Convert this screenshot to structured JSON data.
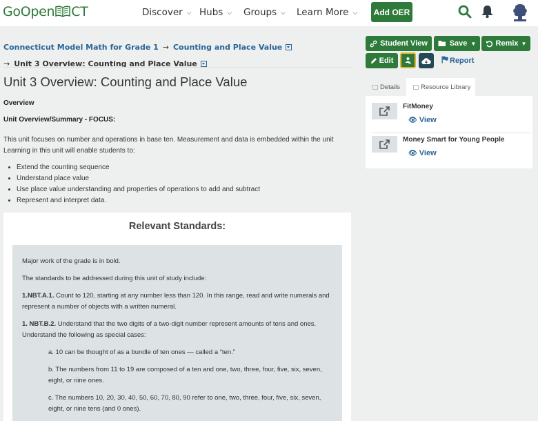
{
  "header": {
    "logo_pre": "GoOpen",
    "logo_post": "CT",
    "nav": [
      {
        "label": "Discover"
      },
      {
        "label": "Hubs"
      },
      {
        "label": "Groups"
      },
      {
        "label": "Learn More"
      }
    ],
    "add_oer_label": "Add OER",
    "colors": {
      "brand_green": "#2d7a3a"
    }
  },
  "breadcrumb": {
    "level1": "Connecticut Model Math for Grade 1",
    "level2": "Counting and Place Value",
    "current": "Unit 3 Overview: Counting and Place Value"
  },
  "page": {
    "title": "Unit 3 Overview: Counting and Place Value",
    "overview_heading": "Overview",
    "summary_heading": "Unit Overview/Summary - FOCUS:",
    "summary_text": "This unit focuses on number and operations in base ten. Measurement and data is embedded within the unit Learning in this unit will enable students to:",
    "bullets": [
      "Extend the counting sequence",
      "Understand place value",
      "Use place value understanding and properties of operations to add and subtract",
      "Represent and interpret data."
    ]
  },
  "standards": {
    "title": "Relevant Standards:",
    "p1": "Major work of the grade is in bold.",
    "p2": "The standards to be addressed during this unit of study include:",
    "s1_code": "1.NBT.A.1.",
    "s1_text": " Count to 120, starting at any number less than 120. In this range, read and write numerals and represent a number of objects with a written numeral.",
    "s2_code": "1. NBT.B.2.",
    "s2_text": " Understand that the two digits of a two-digit number represent amounts of tens and ones. Understand the following as special cases:",
    "a": "a. 10 can be thought of as a bundle of ten ones — called a “ten.”",
    "b": "b. The numbers from 11 to 19 are composed of a ten and one, two, three, four, five, six, seven, eight, or nine ones.",
    "c": "c. The numbers 10, 20, 30, 40, 50, 60, 70, 80, 90 refer to one, two, three, four, five, six, seven, eight, or nine tens (and 0 ones)."
  },
  "actions": {
    "student_view": "Student View",
    "save": "Save",
    "remix": "Remix",
    "edit": "Edit",
    "report": "Report"
  },
  "tabs": {
    "details": "Details",
    "library": "Resource Library"
  },
  "resources": [
    {
      "title": "FitMoney",
      "view": "View"
    },
    {
      "title": "Money Smart for Young People",
      "view": "View"
    }
  ]
}
